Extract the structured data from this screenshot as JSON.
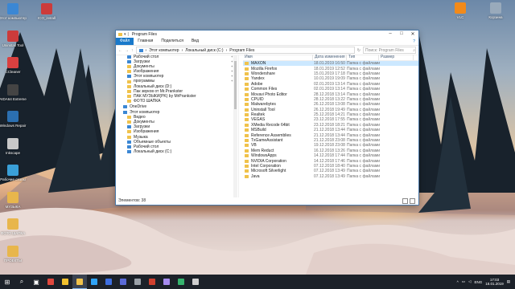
{
  "desktop": {
    "icons_left": [
      {
        "label": "Этот компьютер",
        "color": "#3b87d4"
      },
      {
        "label": "Uninstall Tool",
        "color": "#cc3b3b"
      },
      {
        "label": "CCleaner",
        "color": "#d94040"
      },
      {
        "label": "AIDA64 Extreme",
        "color": "#444"
      },
      {
        "label": "Windows Repair",
        "color": "#2b6fb0"
      },
      {
        "label": "Inkscape",
        "color": "#c8c8c8"
      },
      {
        "label": "Рабочие столы",
        "color": "#3aa0d8"
      },
      {
        "label": "МУЗЫКА",
        "color": "#e8b64c"
      },
      {
        "label": "ФОТО ШАПКА",
        "color": "#e8b64c"
      },
      {
        "label": "ПРОЕКТЫ",
        "color": "#e8b64c"
      }
    ],
    "icons_top": [
      {
        "label": "Этот компьютер",
        "color": "#3b87d4"
      },
      {
        "label": "ICO_install",
        "color": "#cc3b3b"
      }
    ],
    "icons_right": [
      {
        "label": "VLC",
        "color": "#f28a1a"
      },
      {
        "label": "Корзина",
        "color": "#9ab"
      }
    ]
  },
  "window": {
    "title": "Program Files",
    "ribbon_tabs": [
      "Файл",
      "Главная",
      "Поделиться",
      "Вид"
    ],
    "address": [
      "Этот компьютер",
      "Локальный диск (C:)",
      "Program Files"
    ],
    "search_placeholder": "Поиск: Program Files",
    "nav_items": [
      {
        "label": "Рабочий стол",
        "icon": "blue",
        "pinned": true
      },
      {
        "label": "Загрузки",
        "icon": "blue",
        "pinned": true
      },
      {
        "label": "Документы",
        "icon": "folder",
        "pinned": true
      },
      {
        "label": "Изображения",
        "icon": "folder",
        "pinned": true
      },
      {
        "label": "Этот компьютер",
        "icon": "pc",
        "pinned": true
      },
      {
        "label": "программы",
        "icon": "folder",
        "pinned": true
      },
      {
        "label": "Локальный диск (D:)",
        "icon": "folder",
        "pinned": false
      },
      {
        "label": "Пак звуков от Mr.Prankster",
        "icon": "folder",
        "pinned": false
      },
      {
        "label": "ПАК МУЗЫКИ(PK) by MrPrankster",
        "icon": "folder",
        "pinned": false
      },
      {
        "label": "ФОТО ШАПКА",
        "icon": "folder",
        "pinned": false
      }
    ],
    "nav_groups": [
      {
        "label": "OneDrive",
        "icon": "blue"
      },
      {
        "label": "Этот компьютер",
        "icon": "pc"
      }
    ],
    "pc_items": [
      {
        "label": "Видео",
        "icon": "folder"
      },
      {
        "label": "Документы",
        "icon": "folder"
      },
      {
        "label": "Загрузки",
        "icon": "blue"
      },
      {
        "label": "Изображения",
        "icon": "folder"
      },
      {
        "label": "Музыка",
        "icon": "folder"
      },
      {
        "label": "Объемные объекты",
        "icon": "blue"
      },
      {
        "label": "Рабочий стол",
        "icon": "blue"
      },
      {
        "label": "Локальный диск (C:)",
        "icon": "pc"
      }
    ],
    "columns": [
      "Имя",
      "Дата изменения",
      "Тип",
      "Размер"
    ],
    "files": [
      {
        "name": "MAXON",
        "date": "18.01.2019 16:50",
        "type": "Папка с файлами"
      },
      {
        "name": "Mozilla Firefox",
        "date": "18.01.2019 12:52",
        "type": "Папка с файлами"
      },
      {
        "name": "Wondershare",
        "date": "15.01.2019 17:18",
        "type": "Папка с файлами"
      },
      {
        "name": "Yandex",
        "date": "10.01.2019 19:09",
        "type": "Папка с файлами"
      },
      {
        "name": "Adobe",
        "date": "02.01.2019 13:14",
        "type": "Папка с файлами"
      },
      {
        "name": "Common Files",
        "date": "02.01.2019 13:14",
        "type": "Папка с файлами"
      },
      {
        "name": "Movavi Photo Editor",
        "date": "28.12.2018 13:14",
        "type": "Папка с файлами"
      },
      {
        "name": "CPUID",
        "date": "28.12.2018 13:22",
        "type": "Папка с файлами"
      },
      {
        "name": "Malwarebytes",
        "date": "26.12.2018 13:08",
        "type": "Папка с файлами"
      },
      {
        "name": "Uninstall Tool",
        "date": "26.12.2018 19:49",
        "type": "Папка с файлами"
      },
      {
        "name": "Realtek",
        "date": "25.12.2018 14:21",
        "type": "Папка с файлами"
      },
      {
        "name": "VEGAS",
        "date": "23.12.2018 17:55",
        "type": "Папка с файлами"
      },
      {
        "name": "XMedia Recode 64bit",
        "date": "23.12.2018 18:21",
        "type": "Папка с файлами"
      },
      {
        "name": "MSBuild",
        "date": "21.12.2018 13:44",
        "type": "Папка с файлами"
      },
      {
        "name": "Reference Assemblies",
        "date": "21.12.2018 13:44",
        "type": "Папка с файлами"
      },
      {
        "name": "TxGameAssistant",
        "date": "21.12.2018 23:08",
        "type": "Папка с файлами"
      },
      {
        "name": "VB",
        "date": "19.12.2018 23:08",
        "type": "Папка с файлами"
      },
      {
        "name": "Mem Reduct",
        "date": "16.12.2018 13:26",
        "type": "Папка с файлами"
      },
      {
        "name": "WindowsApps",
        "date": "14.12.2018 17:44",
        "type": "Папка с файлами"
      },
      {
        "name": "NVIDIA Corporation",
        "date": "14.12.2018 17:46",
        "type": "Папка с файлами"
      },
      {
        "name": "Intel Corporation",
        "date": "07.12.2018 18:40",
        "type": "Папка с файлами"
      },
      {
        "name": "Microsoft Silverlight",
        "date": "07.12.2018 13:49",
        "type": "Папка с файлами"
      },
      {
        "name": "Java",
        "date": "07.12.2018 13:49",
        "type": "Папка с файлами"
      }
    ],
    "status": "Элементов: 38"
  },
  "taskbar": {
    "apps": [
      {
        "name": "start",
        "color": "#ffffff"
      },
      {
        "name": "search",
        "color": "#ffffff"
      },
      {
        "name": "task-view",
        "color": "#ffffff"
      },
      {
        "name": "chrome",
        "color": "#e0483e"
      },
      {
        "name": "yandex",
        "color": "#f2c12e"
      },
      {
        "name": "explorer",
        "color": "#f0c24b"
      },
      {
        "name": "photoshop",
        "color": "#2fa3f7"
      },
      {
        "name": "app-blue",
        "color": "#3d6ee0"
      },
      {
        "name": "vegas",
        "color": "#5b6bd8"
      },
      {
        "name": "app-gray",
        "color": "#9aa0a8"
      },
      {
        "name": "app-red",
        "color": "#d0402f"
      },
      {
        "name": "premiere",
        "color": "#a78cf0"
      },
      {
        "name": "app-green",
        "color": "#36b36e"
      },
      {
        "name": "app-dark",
        "color": "#cfcfcf"
      }
    ],
    "lang": "ENG",
    "time": "17:03",
    "date": "18.01.2019"
  }
}
